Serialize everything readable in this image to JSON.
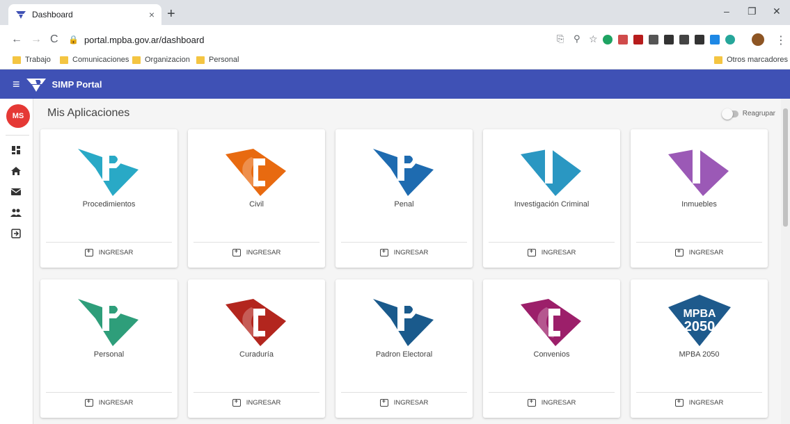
{
  "browser": {
    "tab_title": "Dashboard",
    "tab_close": "×",
    "new_tab": "+",
    "url": "portal.mpba.gov.ar/dashboard",
    "window_controls": [
      "–",
      "❐",
      "✕"
    ],
    "bookmarks": [
      "Trabajo",
      "Comunicaciones",
      "Organizacion",
      "Personal"
    ],
    "other_bookmarks": "Otros marcadores"
  },
  "app": {
    "title": "SIMP Portal",
    "brand_color": "#3f51b5",
    "user_initials": "MS",
    "sidebar_icons": [
      "dashboard-icon",
      "home-icon",
      "mail-icon",
      "people-icon",
      "logout-icon"
    ]
  },
  "main": {
    "title": "Mis Aplicaciones",
    "toggle_label": "Reagrupar",
    "toggle_on": false,
    "action_label": "INGRESAR",
    "apps": [
      {
        "name": "Procedimientos",
        "letter": "P",
        "color": "#29a9c6"
      },
      {
        "name": "Civil",
        "letter": "C",
        "color": "#e86a10"
      },
      {
        "name": "Penal",
        "letter": "P",
        "color": "#1e6bb0"
      },
      {
        "name": "Investigación Criminal",
        "letter": "I",
        "color": "#2a97c2"
      },
      {
        "name": "Inmuebles",
        "letter": "I",
        "color": "#9b59b6"
      },
      {
        "name": "Personal",
        "letter": "P",
        "color": "#2e9e7a"
      },
      {
        "name": "Curaduría",
        "letter": "C",
        "color": "#b3261e"
      },
      {
        "name": "Padron Electoral",
        "letter": "P",
        "color": "#1a5a8c"
      },
      {
        "name": "Convenios",
        "letter": "C",
        "color": "#9c1f6a"
      },
      {
        "name": "MPBA 2050",
        "letter": "MPBA 2050",
        "color": "#1e5a8c"
      }
    ]
  }
}
